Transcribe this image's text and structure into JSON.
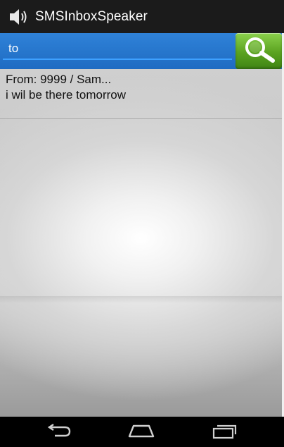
{
  "app": {
    "title": "SMSInboxSpeaker",
    "icon": "speaker-icon"
  },
  "search": {
    "value": "to",
    "button_icon": "search-icon",
    "colors": {
      "bar": "#1f6bc2",
      "button": "#5aa21f"
    }
  },
  "messages": [
    {
      "from": "From:  9999 / Sam...",
      "body": "i wil be there tomorrow"
    }
  ],
  "navigation": {
    "buttons": [
      "back-icon",
      "home-icon",
      "recent-apps-icon"
    ]
  }
}
